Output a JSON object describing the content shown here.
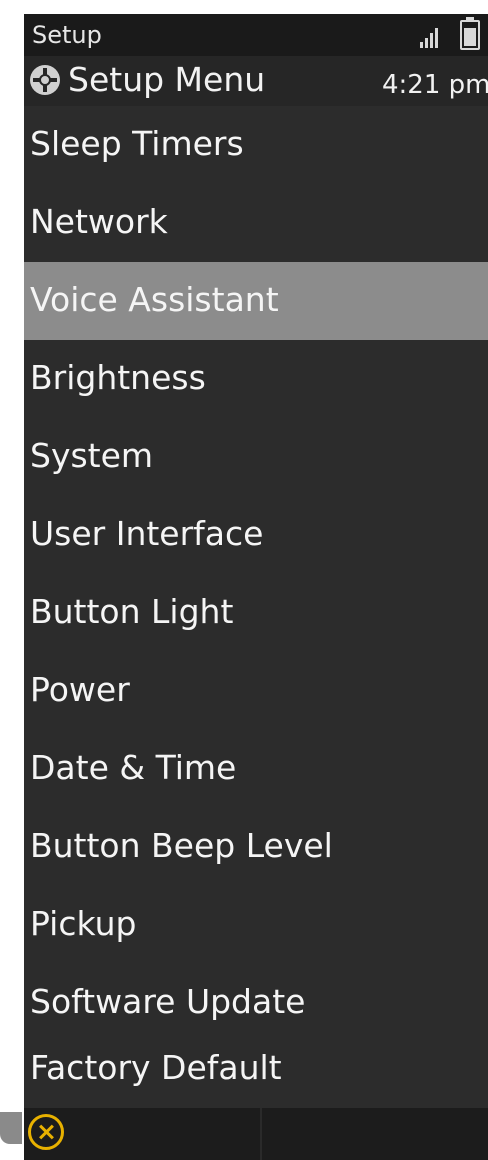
{
  "status_bar": {
    "title": "Setup",
    "signal_icon": "signal-bars-icon",
    "battery_icon": "battery-icon"
  },
  "header": {
    "icon": "setup-gear-icon",
    "title": "Setup Menu",
    "time": "4:21 pm"
  },
  "menu": {
    "selected_index": 2,
    "items": [
      {
        "label": "Sleep Timers"
      },
      {
        "label": "Network"
      },
      {
        "label": "Voice Assistant"
      },
      {
        "label": "Brightness"
      },
      {
        "label": "System"
      },
      {
        "label": "User Interface"
      },
      {
        "label": "Button Light"
      },
      {
        "label": "Power"
      },
      {
        "label": "Date & Time"
      },
      {
        "label": "Button Beep Level"
      },
      {
        "label": "Pickup"
      },
      {
        "label": "Software Update"
      },
      {
        "label": "Factory Default"
      }
    ]
  },
  "softkeys": {
    "left_icon": "close-circle-icon"
  },
  "colors": {
    "background": "#2c2c2c",
    "selected_row": "#8c8c8c",
    "text": "#f5f5f5",
    "close_accent": "#e8b100"
  }
}
